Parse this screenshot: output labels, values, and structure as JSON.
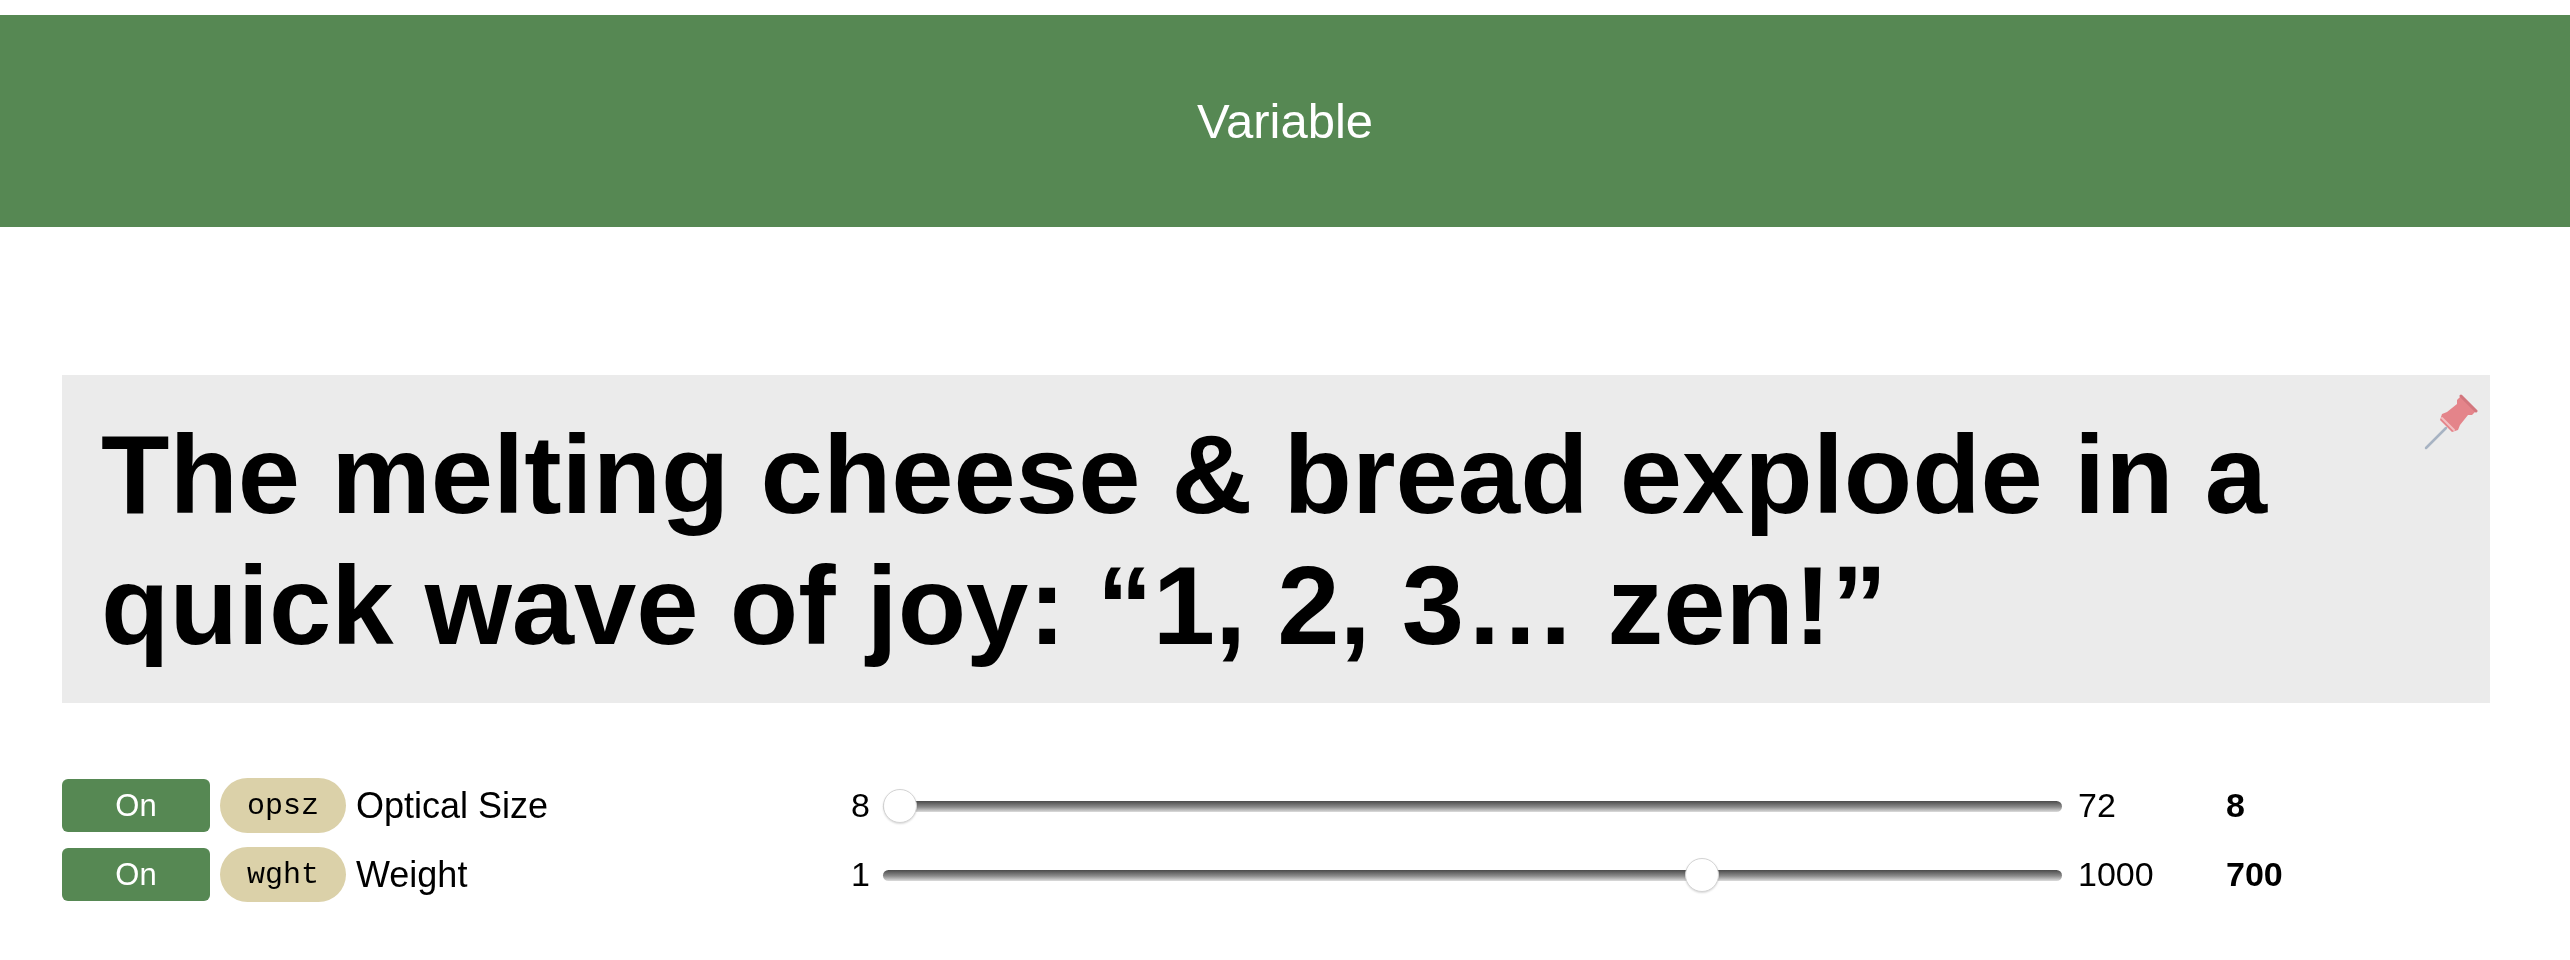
{
  "header": {
    "title": "Variable"
  },
  "sample": {
    "text": "The melting cheese & bread explode in a quick wave of joy: “1, 2, 3… zen!”"
  },
  "axes": [
    {
      "toggle": {
        "label": "On",
        "on": true
      },
      "tag": "opsz",
      "name": "Optical Size",
      "min": "8",
      "max": "72",
      "value": "8",
      "level": 0
    },
    {
      "toggle": {
        "label": "On",
        "on": true
      },
      "tag": "wght",
      "name": "Weight",
      "min": "1",
      "max": "1000",
      "value": "700",
      "level": 0.7
    }
  ]
}
